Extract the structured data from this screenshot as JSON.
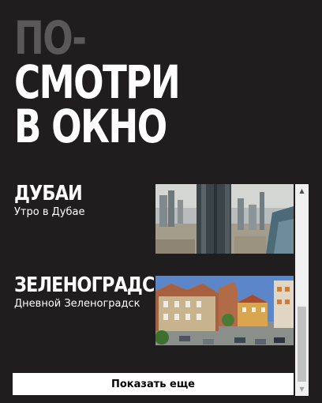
{
  "title": {
    "line1": "ПО-",
    "line2": "СМОТРИ",
    "line3": "В ОКНО"
  },
  "colors": {
    "background": "#1f1d1d",
    "title_dim": "#5a5858",
    "text": "#ffffff"
  },
  "items": [
    {
      "name": "ДУБАИ",
      "subtitle": "Утро в Дубае",
      "image": "dubai-skyline-photo"
    },
    {
      "name": "ЗЕЛЕНОГРАДСК",
      "subtitle": "Дневной Зеленоградск",
      "image": "zelenogradsk-houses-photo"
    }
  ],
  "more_button": {
    "label": "Показать еще"
  },
  "scrollbar": {
    "up_icon": "▲",
    "down_icon": "▼"
  }
}
